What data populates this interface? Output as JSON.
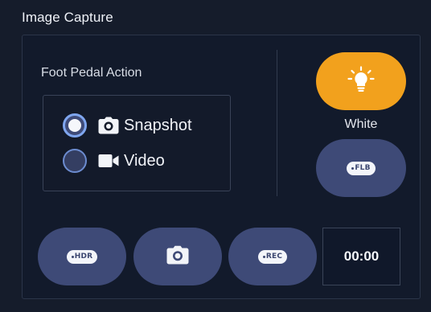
{
  "panel": {
    "title": "Image Capture"
  },
  "foot_pedal": {
    "label": "Foot Pedal Action",
    "options": [
      {
        "label": "Snapshot",
        "icon": "camera-icon",
        "selected": true
      },
      {
        "label": "Video",
        "icon": "video-camera-icon",
        "selected": false
      }
    ]
  },
  "light": {
    "label": "White",
    "icon": "light-bulb-icon",
    "active_color": "#f2a11d"
  },
  "buttons": {
    "flb_badge": "FLB",
    "hdr_badge": "HDR",
    "snapshot_icon": "camera-icon",
    "rec_badge": "REC",
    "button_color": "#3e4a77"
  },
  "timer": {
    "value": "00:00"
  },
  "colors": {
    "background": "#151c2b",
    "panel": "#121a2b",
    "radio_selected_ring": "#7fa6ef",
    "accent_orange": "#f2a11d"
  }
}
